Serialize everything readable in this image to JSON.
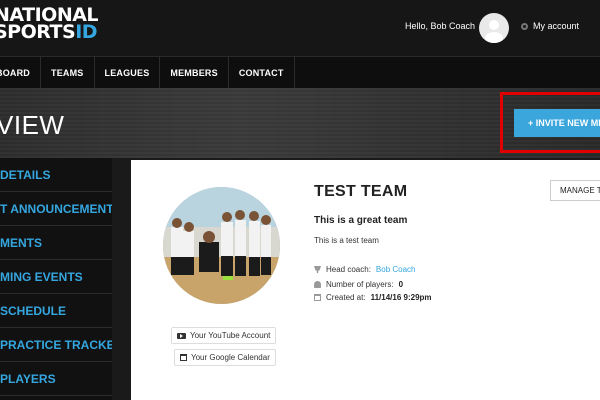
{
  "header": {
    "logo_line1": "NATIONAL",
    "logo_line2_a": "SPORTS",
    "logo_line2_b": "ID",
    "greeting": "Hello, Bob Coach",
    "account_label": "My account"
  },
  "nav": {
    "items": [
      "BOARD",
      "TEAMS",
      "LEAGUES",
      "MEMBERS",
      "CONTACT"
    ]
  },
  "page": {
    "title": "VIEW",
    "invite_label": "INVITE NEW ME"
  },
  "sidebar": {
    "items": [
      "DETAILS",
      "T ANNOUNCEMENTS",
      "MENTS",
      "MING EVENTS",
      "SCHEDULE",
      "PRACTICE TRACKER",
      "PLAYERS"
    ]
  },
  "team": {
    "name": "TEST TEAM",
    "manage_label": "MANAGE TEA",
    "tagline": "This is a great team",
    "description": "This is a test team",
    "head_coach_label": "Head coach:",
    "head_coach": "Bob Coach",
    "players_label": "Number of players:",
    "players_count": "0",
    "created_label": "Created at:",
    "created_at": "11/14/16 9:29pm",
    "youtube_label": "Your YouTube Account",
    "calendar_label": "Your Google Calendar"
  },
  "colors": {
    "accent": "#35a7e0",
    "highlight": "#e00000",
    "header_bg": "#161616"
  }
}
